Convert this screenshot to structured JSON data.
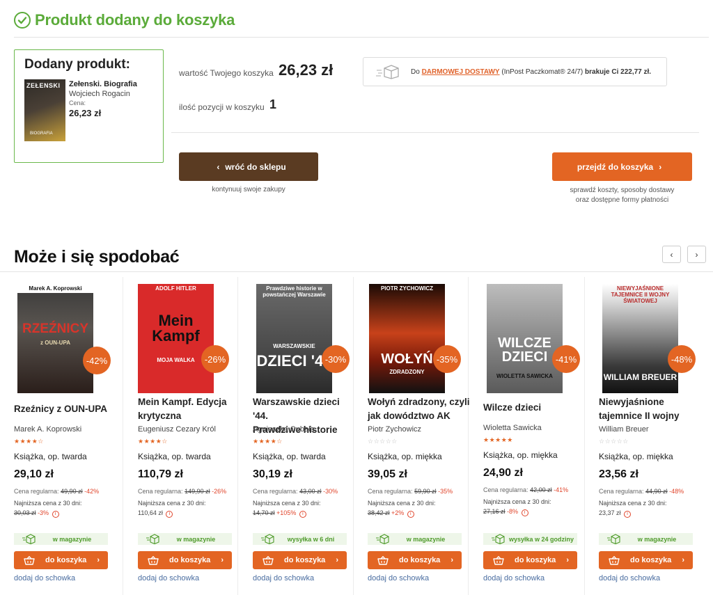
{
  "header": {
    "title": "Produkt dodany do koszyka"
  },
  "added": {
    "title": "Dodany produkt:",
    "cover_title": "ZEŁENSKI",
    "cover_sub": "BIOGRAFIA",
    "name": "Zełenski. Biografia",
    "author": "Wojciech Rogacin",
    "price_label": "Cena:",
    "price": "26,23 zł"
  },
  "cart": {
    "value_label": "wartość Twojego koszyka",
    "value": "26,23 zł",
    "count_label": "ilość pozycji w koszyku",
    "count": "1"
  },
  "delivery": {
    "prefix": "Do ",
    "link": "DARMOWEJ DOSTAWY",
    "middle": " (InPost Paczkomat® 24/7) ",
    "suffix": "brakuje Ci 222,77 zł."
  },
  "actions": {
    "back_label": "wróć do sklepu",
    "back_sub": "kontynuuj swoje zakupy",
    "checkout_label": "przejdź do koszyka",
    "checkout_sub1": "sprawdź koszty, sposoby dostawy",
    "checkout_sub2": "oraz dostępne formy płatności"
  },
  "recommendations": {
    "title": "Może  i się spodobać",
    "prev": "‹",
    "next": "›"
  },
  "products": [
    {
      "cover_top": "Marek A. Koprowski",
      "cover_title": "RZEŹNICY",
      "cover_sub": "z OUN-UPA",
      "discount": "-42%",
      "title_line1": "Rzeźnicy z OUN-UPA",
      "title_line2": "",
      "author": "Marek A. Koprowski",
      "stars": "★★★★☆",
      "format": "Książka, op. twarda",
      "price": "29,10 zł",
      "reg_label": "Cena regularna:",
      "reg_price": "49,90 zł",
      "reg_disc": "-42%",
      "low_label": "Najniższa cena z 30 dni:",
      "low_price": "30,03 zł",
      "low_change": "-3%",
      "availability": "w magazynie",
      "cart_label": "do koszyka",
      "stash": "dodaj do schowka"
    },
    {
      "cover_top": "ADOLF HITLER",
      "cover_title": "Mein Kampf",
      "cover_sub": "MOJA WALKA",
      "discount": "-26%",
      "title_line1": "Mein Kampf. Edycja",
      "title_line2": "krytyczna",
      "author": "Eugeniusz Cezary Król",
      "stars": "★★★★☆",
      "format": "Książka, op. twarda",
      "price": "110,79 zł",
      "reg_label": "Cena regularna:",
      "reg_price": "149,90 zł",
      "reg_disc": "-26%",
      "low_label": "Najniższa cena z 30 dni:",
      "low_price": "110,64 zł",
      "low_change": "",
      "availability": "w magazynie",
      "cart_label": "do koszyka",
      "stash": "dodaj do schowka"
    },
    {
      "cover_top": "Prawdziwe historie w powstańczej Warszawie",
      "cover_title": "DZIECI '44",
      "cover_sub": "WARSZAWSKIE",
      "discount": "-30%",
      "title_line1": "Warszawskie dzieci '44.",
      "title_line2": "Prawdziwe historie",
      "author": "Agnieszka Cubała",
      "stars": "★★★★☆",
      "format": "Książka, op. twarda",
      "price": "30,19 zł",
      "reg_label": "Cena regularna:",
      "reg_price": "43,00 zł",
      "reg_disc": "-30%",
      "low_label": "Najniższa cena z 30 dni:",
      "low_price": "14,70 zł",
      "low_change": "+105%",
      "availability": "wysyłka w 6 dni",
      "cart_label": "do koszyka",
      "stash": "dodaj do schowka"
    },
    {
      "cover_top": "PIOTR ZYCHOWICZ",
      "cover_title": "WOŁYŃ",
      "cover_sub": "ZDRADZONY",
      "discount": "-35%",
      "title_line1": "Wołyń zdradzony, czyli",
      "title_line2": "jak dowództwo AK",
      "author": "Piotr Zychowicz",
      "stars": "☆☆☆☆☆",
      "format": "Książka, op. miękka",
      "price": "39,05 zł",
      "reg_label": "Cena regularna:",
      "reg_price": "59,90 zł",
      "reg_disc": "-35%",
      "low_label": "Najniższa cena z 30 dni:",
      "low_price": "38,42 zł",
      "low_change": "+2%",
      "availability": "w magazynie",
      "cart_label": "do koszyka",
      "stash": "dodaj do schowka"
    },
    {
      "cover_top": "",
      "cover_title": "WILCZE DZIECI",
      "cover_sub": "WIOLETTA SAWICKA",
      "discount": "-41%",
      "title_line1": "Wilcze dzieci",
      "title_line2": "",
      "author": "Wioletta Sawicka",
      "stars": "★★★★★",
      "format": "Książka, op. miękka",
      "price": "24,90 zł",
      "reg_label": "Cena regularna:",
      "reg_price": "42,00 zł",
      "reg_disc": "-41%",
      "low_label": "Najniższa cena z 30 dni:",
      "low_price": "27,16 zł",
      "low_change": "-8%",
      "availability": "wysyłka w 24 godziny",
      "cart_label": "do koszyka",
      "stash": "dodaj do schowka"
    },
    {
      "cover_top": "NIEWYJAŚNIONE TAJEMNICE II WOJNY ŚWIATOWEJ",
      "cover_title": "WILLIAM BREUER",
      "cover_sub": "",
      "discount": "-48%",
      "title_line1": "Niewyjaśnione",
      "title_line2": "tajemnice II wojny",
      "author": "William Breuer",
      "stars": "☆☆☆☆☆",
      "format": "Książka, op. miękka",
      "price": "23,56 zł",
      "reg_label": "Cena regularna:",
      "reg_price": "44,90 zł",
      "reg_disc": "-48%",
      "low_label": "Najniższa cena z 30 dni:",
      "low_price": "23,37 zł",
      "low_change": "",
      "availability": "w magazynie",
      "cart_label": "do koszyka",
      "stash": "dodaj do schowka"
    }
  ],
  "colors": {
    "success": "#5bab3a",
    "accent": "#e36523",
    "back_button": "#5a3b22",
    "link": "#4a6da0",
    "discount_text": "#e0442a"
  }
}
